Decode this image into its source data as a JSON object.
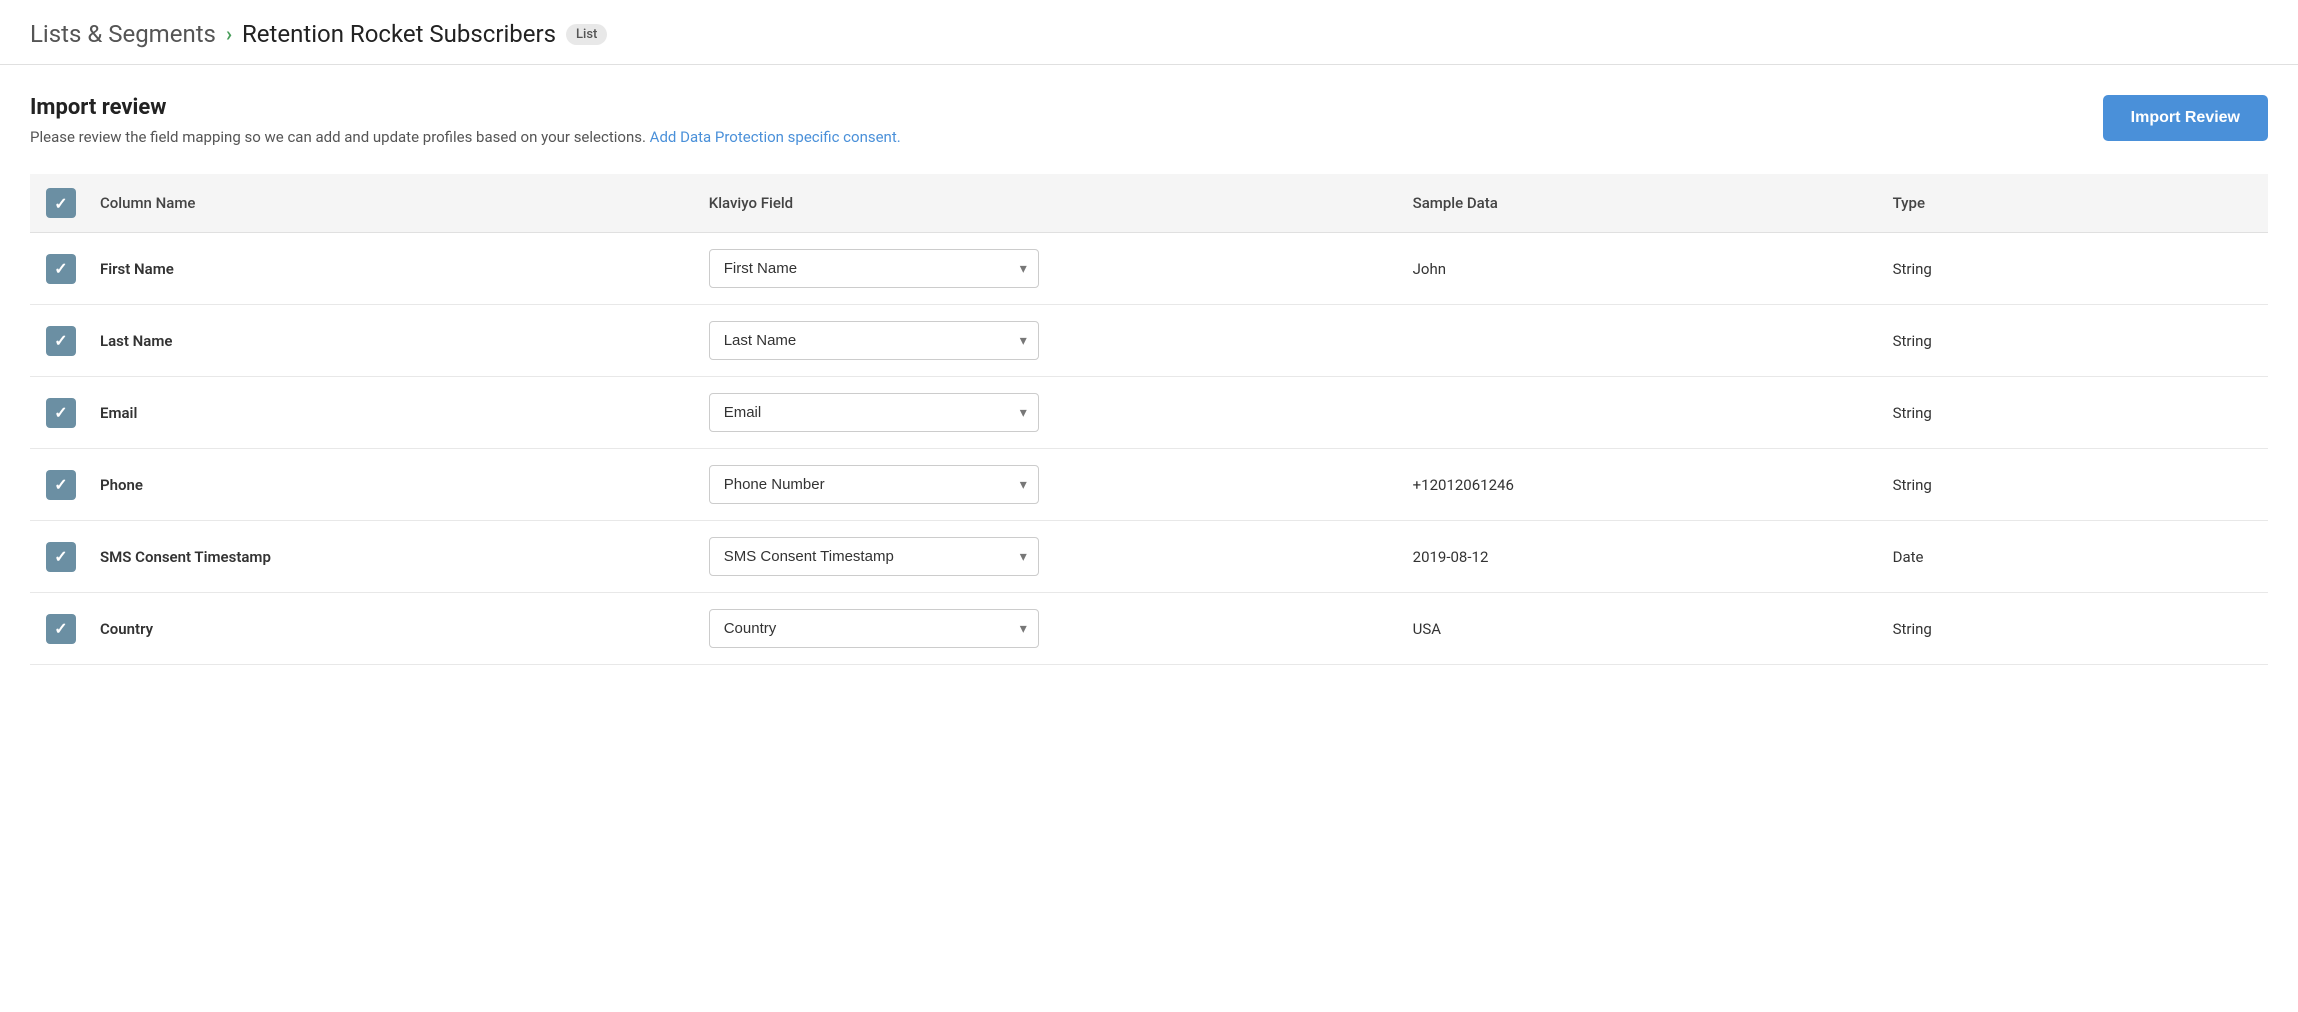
{
  "breadcrumb": {
    "parent": "Lists & Segments",
    "arrow": "›",
    "current": "Retention Rocket Subscribers",
    "badge": "List"
  },
  "import_review": {
    "title": "Import review",
    "description": "Please review the field mapping so we can add and update profiles based on your selections.",
    "link_text": "Add Data Protection specific consent.",
    "button_label": "Import Review"
  },
  "table": {
    "headers": [
      "",
      "Column Name",
      "Klaviyo Field",
      "Sample Data",
      "Type"
    ],
    "rows": [
      {
        "checked": true,
        "column_name": "First Name",
        "klaviyo_field": "First Name",
        "sample_data": "John",
        "type": "String"
      },
      {
        "checked": true,
        "column_name": "Last Name",
        "klaviyo_field": "Last Name",
        "sample_data": "",
        "type": "String"
      },
      {
        "checked": true,
        "column_name": "Email",
        "klaviyo_field": "Email",
        "sample_data": "",
        "type": "String"
      },
      {
        "checked": true,
        "column_name": "Phone",
        "klaviyo_field": "Phone Number",
        "sample_data": "+12012061246",
        "type": "String"
      },
      {
        "checked": true,
        "column_name": "SMS Consent Timestamp",
        "klaviyo_field": "SMS Consent Timestamp",
        "sample_data": "2019-08-12",
        "type": "Date"
      },
      {
        "checked": true,
        "column_name": "Country",
        "klaviyo_field": "Country",
        "sample_data": "USA",
        "type": "String"
      }
    ]
  }
}
